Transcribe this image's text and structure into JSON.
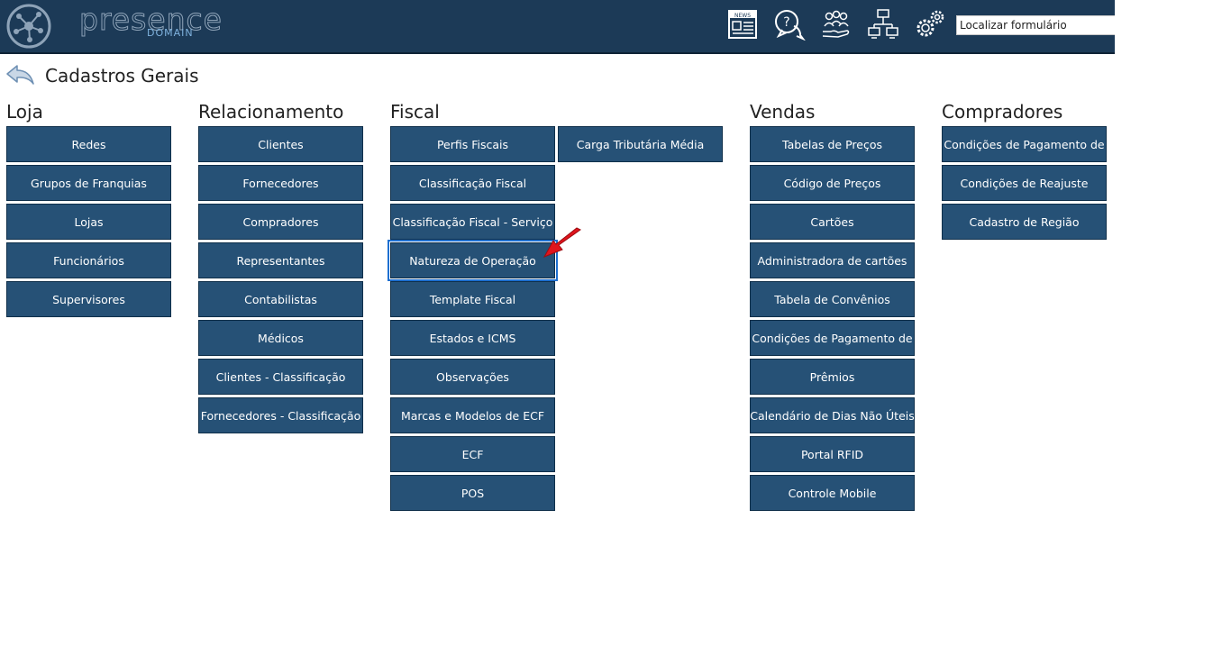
{
  "header": {
    "logo_text": "presence",
    "logo_sub": "DOMAIN",
    "search_placeholder": "Localizar formulário",
    "icons": [
      "news-icon",
      "help-chat-icon",
      "users-hand-icon",
      "network-computers-icon",
      "gear-icon"
    ]
  },
  "page": {
    "title": "Cadastros Gerais"
  },
  "sections": {
    "loja": {
      "title": "Loja",
      "items": [
        "Redes",
        "Grupos de Franquias",
        "Lojas",
        "Funcionários",
        "Supervisores"
      ]
    },
    "relacionamento": {
      "title": "Relacionamento",
      "items": [
        "Clientes",
        "Fornecedores",
        "Compradores",
        "Representantes",
        "Contabilistas",
        "Médicos",
        "Clientes - Classificação",
        "Fornecedores - Classificação"
      ]
    },
    "fiscal": {
      "title": "Fiscal",
      "items": [
        "Perfis Fiscais",
        "Classificação Fiscal",
        "Classificação Fiscal - Serviço",
        "Natureza de Operação",
        "Template Fiscal",
        "Estados e ICMS",
        "Observações",
        "Marcas e Modelos de ECF",
        "ECF",
        "POS"
      ],
      "items_col2": [
        "Carga Tributária Média"
      ]
    },
    "vendas": {
      "title": "Vendas",
      "items": [
        "Tabelas de Preços",
        "Código de Preços",
        "Cartões",
        "Administradora de cartões",
        "Tabela de Convênios",
        "Condições de Pagamento de",
        "Prêmios",
        "Calendário de Dias Não Úteis",
        "Portal RFID",
        "Controle Mobile"
      ]
    },
    "compradores": {
      "title": "Compradores",
      "items": [
        "Condições de Pagamento de",
        "Condições de Reajuste",
        "Cadastro de Região"
      ]
    }
  },
  "colors": {
    "header_bg": "#1c3a57",
    "button_bg": "#265176",
    "highlight": "#1e6fd0",
    "arrow": "#e0141c"
  }
}
